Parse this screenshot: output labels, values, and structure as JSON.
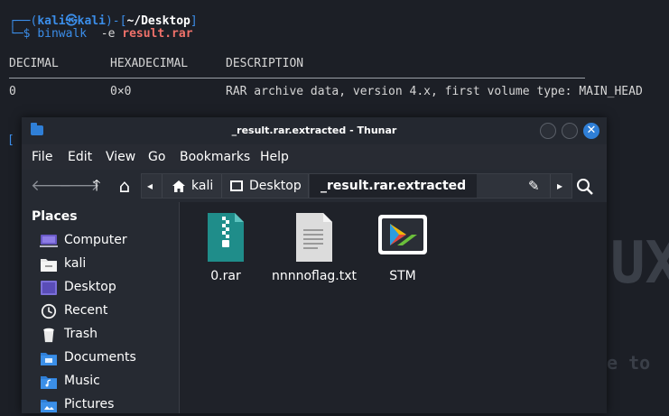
{
  "terminal": {
    "prompt_open": "┌──(",
    "user": "kali",
    "at": "㉿",
    "host": "kali",
    "prompt_mid": ")-[",
    "cwd": "~/Desktop",
    "prompt_close": "]",
    "prompt2": "└─$ ",
    "cmd": "binwalk",
    "cmd_args": "  -e ",
    "cmd_file": "result.rar",
    "header_decimal": "DECIMAL",
    "header_hex": "HEXADECIMAL",
    "header_desc": "DESCRIPTION",
    "row_decimal": "0",
    "row_hex": "0×0",
    "row_desc": "RAR archive data, version 4.x, first volume type: MAIN_HEAD",
    "partial_prompt": "[",
    "watermark_text": "e to",
    "watermark_big": "UX"
  },
  "window": {
    "title": "_result.rar.extracted - Thunar",
    "close_symbol": "✕"
  },
  "menu": [
    "File",
    "Edit",
    "View",
    "Go",
    "Bookmarks",
    "Help"
  ],
  "toolbar": {
    "back": "🡐",
    "forward": "🡒",
    "up": "🡑",
    "home": "⌂",
    "crumb_left": "◂",
    "crumb_right": "▸",
    "edit": "✎",
    "search": "⚲"
  },
  "pathbar": {
    "crumbs": [
      "kali",
      "Desktop",
      "_result.rar.extracted"
    ]
  },
  "sidebar": {
    "heading": "Places",
    "items": [
      {
        "label": "Computer",
        "icon": "computer-icon"
      },
      {
        "label": "kali",
        "icon": "home-folder-icon"
      },
      {
        "label": "Desktop",
        "icon": "desktop-icon"
      },
      {
        "label": "Recent",
        "icon": "recent-icon"
      },
      {
        "label": "Trash",
        "icon": "trash-icon"
      },
      {
        "label": "Documents",
        "icon": "documents-folder-icon"
      },
      {
        "label": "Music",
        "icon": "music-folder-icon"
      },
      {
        "label": "Pictures",
        "icon": "pictures-folder-icon"
      }
    ]
  },
  "files": [
    {
      "name": "0.rar",
      "icon": "archive-file-icon"
    },
    {
      "name": "nnnnoflag.txt",
      "icon": "text-file-icon"
    },
    {
      "name": "STM",
      "icon": "application-icon"
    }
  ],
  "colors": {
    "accent": "#2f7fd7",
    "prompt_blue": "#3b8eea",
    "highlight_red": "#f0716a"
  }
}
